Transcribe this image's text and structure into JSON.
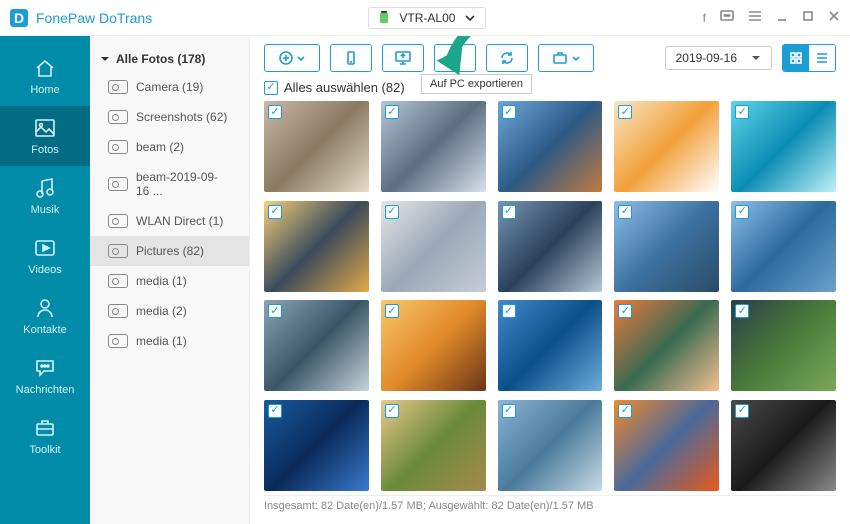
{
  "app": {
    "title": "FonePaw DoTrans"
  },
  "device": {
    "name": "VTR-AL00"
  },
  "nav": [
    {
      "id": "home",
      "label": "Home",
      "icon": "home"
    },
    {
      "id": "fotos",
      "label": "Fotos",
      "icon": "image",
      "active": true
    },
    {
      "id": "musik",
      "label": "Musik",
      "icon": "music"
    },
    {
      "id": "videos",
      "label": "Videos",
      "icon": "video"
    },
    {
      "id": "kontakte",
      "label": "Kontakte",
      "icon": "contact"
    },
    {
      "id": "nachrichten",
      "label": "Nachrichten",
      "icon": "message"
    },
    {
      "id": "toolkit",
      "label": "Toolkit",
      "icon": "briefcase"
    }
  ],
  "sidebar": {
    "header": "Alle Fotos (178)",
    "items": [
      {
        "label": "Camera (19)"
      },
      {
        "label": "Screenshots (62)"
      },
      {
        "label": "beam (2)"
      },
      {
        "label": "beam-2019-09-16 ..."
      },
      {
        "label": "WLAN Direct (1)"
      },
      {
        "label": "Pictures (82)",
        "active": true
      },
      {
        "label": "media (1)"
      },
      {
        "label": "media (2)"
      },
      {
        "label": "media (1)"
      }
    ]
  },
  "toolbar": {
    "add": "add",
    "to_device": "to-device",
    "to_pc": "to-pc",
    "delete": "delete",
    "refresh": "refresh",
    "folder": "folder",
    "date": "2019-09-16",
    "tooltip": "Auf PC exportieren"
  },
  "select_all": {
    "label": "Alles auswählen (82)",
    "checked": true
  },
  "status": "Insgesamt: 82 Date(en)/1.57 MB; Ausgewählt: 82 Date(en)/1.57 MB",
  "thumbs": [
    {
      "g": [
        "#c9b8a4",
        "#8a7a62",
        "#e6dcc7"
      ]
    },
    {
      "g": [
        "#b6c6d8",
        "#5b6e82",
        "#d8e0ea"
      ]
    },
    {
      "g": [
        "#6ea6d8",
        "#2b5a86",
        "#c07a3f"
      ]
    },
    {
      "g": [
        "#f8e6c4",
        "#f2a03a",
        "#ffffff"
      ]
    },
    {
      "g": [
        "#5fd4e8",
        "#0b8db3",
        "#bff1f9"
      ]
    },
    {
      "g": [
        "#f5cf7a",
        "#3a4a5a",
        "#e4a94a"
      ]
    },
    {
      "g": [
        "#e6e6e6",
        "#9aa8b8",
        "#c6cdd6"
      ]
    },
    {
      "g": [
        "#7695b3",
        "#2a415a",
        "#b6c8d9"
      ]
    },
    {
      "g": [
        "#8fbde8",
        "#3c71a0",
        "#2a4b68"
      ]
    },
    {
      "g": [
        "#8dbfe8",
        "#2c6a9c",
        "#6ca2cc"
      ]
    },
    {
      "g": [
        "#8aa6b6",
        "#3a5666",
        "#c6d4dc"
      ]
    },
    {
      "g": [
        "#f9c76a",
        "#e28a2a",
        "#6b3518"
      ]
    },
    {
      "g": [
        "#4488cc",
        "#0b4f8a",
        "#6faedd"
      ]
    },
    {
      "g": [
        "#ed7a3a",
        "#3a6a52",
        "#f3c090"
      ]
    },
    {
      "g": [
        "#2a3f4a",
        "#4a7a3a",
        "#7aa858"
      ]
    },
    {
      "g": [
        "#1a5aa0",
        "#0a2a5a",
        "#3a7acc"
      ]
    },
    {
      "g": [
        "#eac78a",
        "#6a8a3a",
        "#a68a4a"
      ]
    },
    {
      "g": [
        "#8ab4d4",
        "#4a7a9a",
        "#c7dae6"
      ]
    },
    {
      "g": [
        "#f28a2a",
        "#4a6a9a",
        "#e85a1a"
      ]
    },
    {
      "g": [
        "#4a4a4a",
        "#1a1a1a",
        "#8a8a8a"
      ]
    }
  ]
}
